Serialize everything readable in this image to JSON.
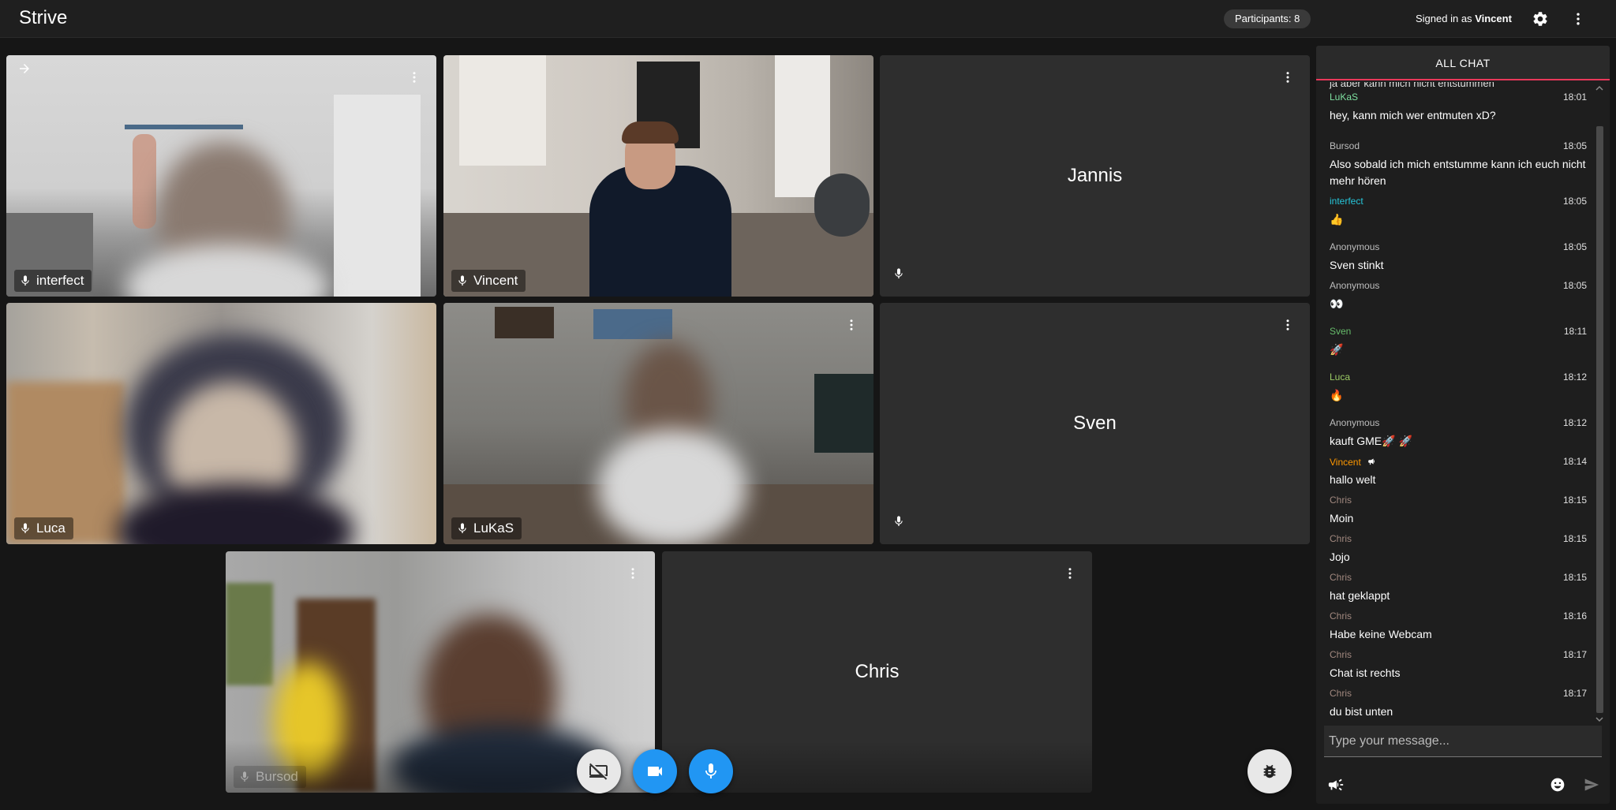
{
  "app": {
    "title": "Strive"
  },
  "header": {
    "participants": "Participants: 8",
    "signed_in_prefix": "Signed in as",
    "signed_in_user": "Vincent",
    "settings_icon": "gear-icon",
    "more_icon": "more-vert-icon"
  },
  "tiles": [
    {
      "name": "interfect",
      "video": true
    },
    {
      "name": "Vincent",
      "video": true
    },
    {
      "name": "Jannis",
      "video": false
    },
    {
      "name": "Luca",
      "video": true
    },
    {
      "name": "LuKaS",
      "video": true
    },
    {
      "name": "Sven",
      "video": false
    },
    {
      "name": "Bursod",
      "video": true
    },
    {
      "name": "Chris",
      "video": false
    }
  ],
  "controls": {
    "screen_share_icon": "screen-share-off-icon",
    "camera_icon": "videocam-icon",
    "mic_icon": "mic-icon",
    "debug_icon": "bug-icon"
  },
  "chat": {
    "header": "ALL CHAT",
    "cut_off_text": "ja aber kann mich nicht entstummen",
    "messages": [
      {
        "author": "LuKaS",
        "time": "18:01",
        "text": "hey, kann mich wer entmuten xD?",
        "color": "#7ee0a0"
      },
      {
        "author": "Bursod",
        "time": "18:05",
        "text": "Also sobald ich mich entstumme kann ich euch nicht mehr hören",
        "color": "#bdbdbd"
      },
      {
        "author": "interfect",
        "time": "18:05",
        "text": "👍",
        "color": "#26c6da"
      },
      {
        "author": "Anonymous",
        "time": "18:05",
        "text": "Sven stinkt",
        "color": "#bdbdbd"
      },
      {
        "author": "Anonymous",
        "time": "18:05",
        "text": "👀",
        "color": "#bdbdbd"
      },
      {
        "author": "Sven",
        "time": "18:11",
        "text": "🚀",
        "color": "#66bb6a"
      },
      {
        "author": "Luca",
        "time": "18:12",
        "text": "🔥",
        "color": "#9ccc65"
      },
      {
        "author": "Anonymous",
        "time": "18:12",
        "text": "kauft GME🚀 🚀",
        "color": "#bdbdbd"
      },
      {
        "author": "Vincent",
        "time": "18:14",
        "text": "hallo welt",
        "color": "#ff9800"
      },
      {
        "author": "Chris",
        "time": "18:15",
        "text": "Moin",
        "color": "#a1887f"
      },
      {
        "author": "Chris",
        "time": "18:15",
        "text": "Jojo",
        "color": "#a1887f"
      },
      {
        "author": "Chris",
        "time": "18:15",
        "text": "hat geklappt",
        "color": "#a1887f"
      },
      {
        "author": "Chris",
        "time": "18:16",
        "text": "Habe keine Webcam",
        "color": "#a1887f"
      },
      {
        "author": "Chris",
        "time": "18:17",
        "text": "Chat ist rechts",
        "color": "#a1887f"
      },
      {
        "author": "Chris",
        "time": "18:17",
        "text": "du bist unten",
        "color": "#a1887f"
      }
    ],
    "input_placeholder": "Type your message...",
    "announce_icon": "megaphone-icon",
    "emoji_icon": "emoji-icon",
    "send_icon": "send-icon"
  }
}
